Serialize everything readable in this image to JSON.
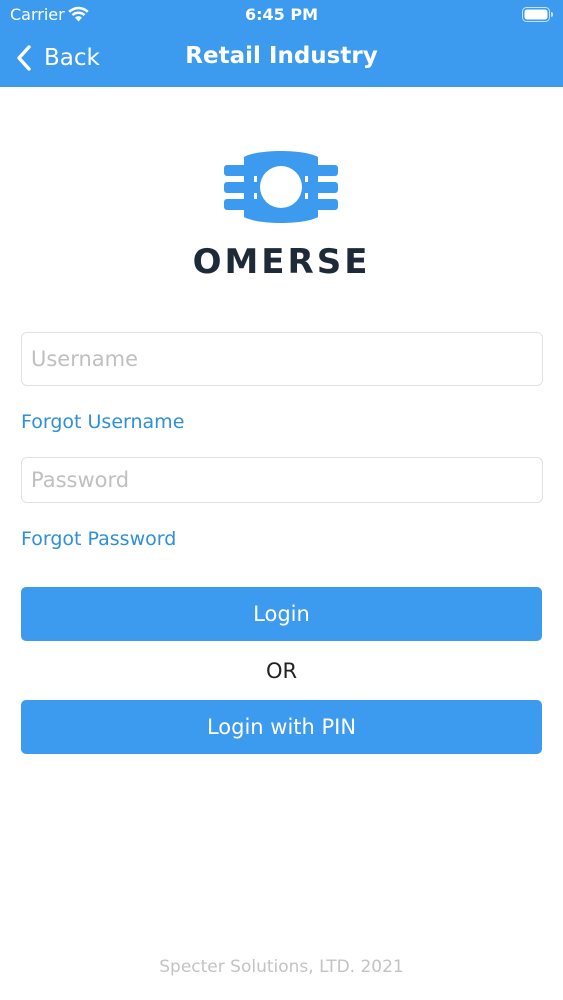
{
  "status_bar": {
    "carrier": "Carrier",
    "time": "6:45 PM",
    "wifi_icon": "wifi-icon",
    "battery_icon": "battery-icon"
  },
  "nav": {
    "back_label": "Back",
    "title": "Retail Industry"
  },
  "logo": {
    "text": "OMERSE",
    "mark_color": "#3d9bef",
    "text_color": "#1e2a38"
  },
  "form": {
    "username_placeholder": "Username",
    "username_value": "",
    "forgot_username": "Forgot Username",
    "password_placeholder": "Password",
    "password_value": "",
    "forgot_password": "Forgot Password",
    "login_button": "Login",
    "or_text": "OR",
    "pin_button": "Login with PIN"
  },
  "footer": {
    "text": "Specter Solutions, LTD. 2021"
  },
  "colors": {
    "accent": "#3d9bef",
    "link": "#2f8fd8",
    "footer_text": "#c3c3c3"
  }
}
